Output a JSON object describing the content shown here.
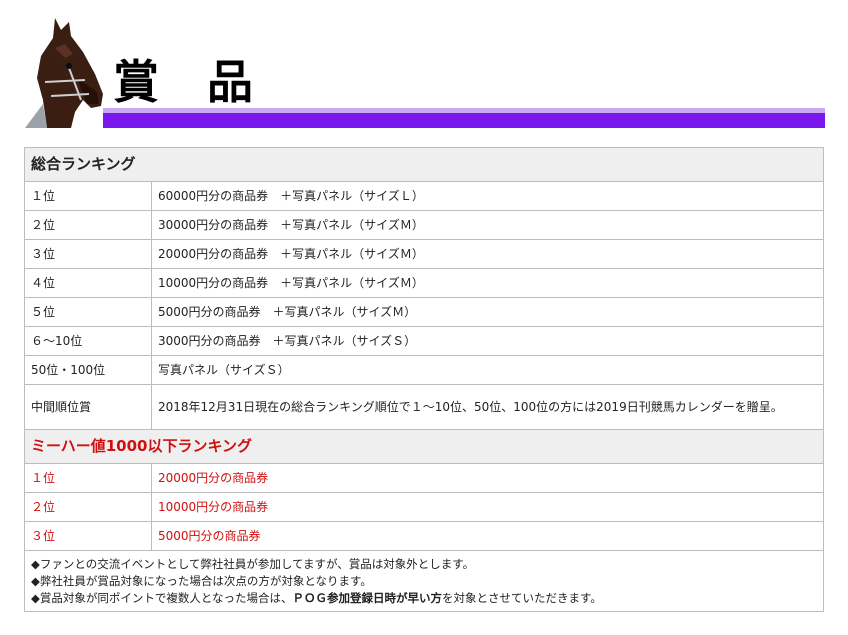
{
  "header": {
    "title": "賞 品"
  },
  "sections": [
    {
      "title": "総合ランキング",
      "rows": [
        {
          "rank": "１位",
          "prize": "60000円分の商品券　＋写真パネル（サイズＬ）"
        },
        {
          "rank": "２位",
          "prize": "30000円分の商品券　＋写真パネル（サイズＭ）"
        },
        {
          "rank": "３位",
          "prize": "20000円分の商品券　＋写真パネル（サイズＭ）"
        },
        {
          "rank": "４位",
          "prize": "10000円分の商品券　＋写真パネル（サイズＭ）"
        },
        {
          "rank": "５位",
          "prize": "5000円分の商品券　＋写真パネル（サイズＭ）"
        },
        {
          "rank": "６～10位",
          "prize": "3000円分の商品券　＋写真パネル（サイズＳ）"
        },
        {
          "rank": "50位・100位",
          "prize": "写真パネル（サイズＳ）"
        },
        {
          "rank": "中間順位賞",
          "prize": "2018年12月31日現在の総合ランキング順位で１～10位、50位、100位の方には2019日刊競馬カレンダーを贈呈。"
        }
      ]
    },
    {
      "title": "ミーハー値1000以下ランキング",
      "rows": [
        {
          "rank": "１位",
          "prize": "20000円分の商品券"
        },
        {
          "rank": "２位",
          "prize": "10000円分の商品券"
        },
        {
          "rank": "３位",
          "prize": "5000円分の商品券"
        }
      ]
    }
  ],
  "notes": {
    "line1": "◆ファンとの交流イベントとして弊社社員が参加してますが、賞品は対象外とします。",
    "line2": "◆弊社社員が賞品対象になった場合は次点の方が対象となります。",
    "line3_pre": "◆賞品対象が同ポイントで複数人となった場合は、",
    "line3_bold": "ＰＯＧ参加登録日時が早い方",
    "line3_post": "を対象とさせていただきます。"
  },
  "colors": {
    "accent_purple": "#7a16ee",
    "highlight_red": "#d01010"
  }
}
